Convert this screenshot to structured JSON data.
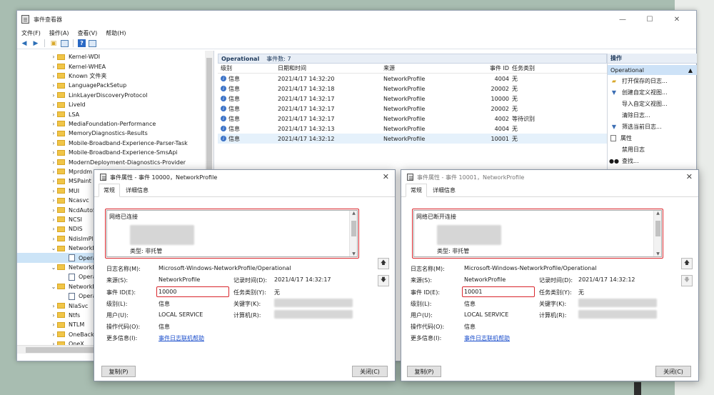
{
  "window": {
    "title": "事件查看器"
  },
  "menu": [
    "文件(F)",
    "操作(A)",
    "查看(V)",
    "帮助(H)"
  ],
  "tree": {
    "items": [
      {
        "label": "Kernel-WDI",
        "type": "folder"
      },
      {
        "label": "Kernel-WHEA",
        "type": "folder"
      },
      {
        "label": "Known 文件夹",
        "type": "folder"
      },
      {
        "label": "LanguagePackSetup",
        "type": "folder"
      },
      {
        "label": "LinkLayerDiscoveryProtocol",
        "type": "folder"
      },
      {
        "label": "Liveld",
        "type": "folder"
      },
      {
        "label": "LSA",
        "type": "folder"
      },
      {
        "label": "MediaFoundation-Performance",
        "type": "folder"
      },
      {
        "label": "MemoryDiagnostics-Results",
        "type": "folder"
      },
      {
        "label": "Mobile-Broadband-Experience-Parser-Task",
        "type": "folder"
      },
      {
        "label": "Mobile-Broadband-Experience-SmsApi",
        "type": "folder"
      },
      {
        "label": "ModernDeployment-Diagnostics-Provider",
        "type": "folder"
      },
      {
        "label": "Mprddm",
        "type": "folder"
      },
      {
        "label": "MSPaint",
        "type": "folder"
      },
      {
        "label": "MUI",
        "type": "folder"
      },
      {
        "label": "Ncasvc",
        "type": "folder"
      },
      {
        "label": "NcdAutoS",
        "type": "folder"
      },
      {
        "label": "NCSI",
        "type": "folder"
      },
      {
        "label": "NDIS",
        "type": "folder"
      },
      {
        "label": "NdisImPla",
        "type": "folder"
      },
      {
        "label": "NetworkP",
        "type": "folder-open"
      },
      {
        "label": "Opera",
        "type": "log",
        "selected": true
      },
      {
        "label": "NetworkP",
        "type": "folder-open"
      },
      {
        "label": "Opera",
        "type": "log"
      },
      {
        "label": "NetworkP",
        "type": "folder-open"
      },
      {
        "label": "Opera",
        "type": "log"
      },
      {
        "label": "NlaSvc",
        "type": "folder"
      },
      {
        "label": "Ntfs",
        "type": "folder"
      },
      {
        "label": "NTLM",
        "type": "folder"
      },
      {
        "label": "OneBacku",
        "type": "folder"
      },
      {
        "label": "OneX",
        "type": "folder"
      }
    ]
  },
  "center": {
    "header_title": "Operational",
    "header_count": "事件数: 7",
    "columns": [
      "级别",
      "日期和时间",
      "来源",
      "事件 ID",
      "任务类别"
    ],
    "rows": [
      {
        "level": "信息",
        "time": "2021/4/17 14:32:20",
        "source": "NetworkProfile",
        "id": "4004",
        "task": "无"
      },
      {
        "level": "信息",
        "time": "2021/4/17 14:32:18",
        "source": "NetworkProfile",
        "id": "20002",
        "task": "无"
      },
      {
        "level": "信息",
        "time": "2021/4/17 14:32:17",
        "source": "NetworkProfile",
        "id": "10000",
        "task": "无"
      },
      {
        "level": "信息",
        "time": "2021/4/17 14:32:17",
        "source": "NetworkProfile",
        "id": "20002",
        "task": "无"
      },
      {
        "level": "信息",
        "time": "2021/4/17 14:32:17",
        "source": "NetworkProfile",
        "id": "4002",
        "task": "等待识别"
      },
      {
        "level": "信息",
        "time": "2021/4/17 14:32:13",
        "source": "NetworkProfile",
        "id": "4004",
        "task": "无"
      },
      {
        "level": "信息",
        "time": "2021/4/17 14:32:12",
        "source": "NetworkProfile",
        "id": "10001",
        "task": "无"
      }
    ]
  },
  "actions": {
    "header": "操作",
    "selected": "Operational",
    "items": [
      "打开保存的日志...",
      "创建自定义视图...",
      "导入自定义视图...",
      "清除日志...",
      "筛选当前日志...",
      "属性",
      "禁用日志",
      "查找..."
    ]
  },
  "dialog1": {
    "title": "事件属性 - 事件 10000，NetworkProfile",
    "tab_general": "常规",
    "tab_details": "详细信息",
    "desc_line1": "网络已连接",
    "desc_type": "类型: 非托管",
    "log_name_label": "日志名称(M):",
    "log_name": "Microsoft-Windows-NetworkProfile/Operational",
    "source_label": "来源(S):",
    "source": "NetworkProfile",
    "logged_label": "记录时间(D):",
    "logged": "2021/4/17 14:32:17",
    "event_id_label": "事件 ID(E):",
    "event_id": "10000",
    "task_label": "任务类别(Y):",
    "task": "无",
    "level_label": "级别(L):",
    "level": "信息",
    "keywords_label": "关键字(K):",
    "user_label": "用户(U):",
    "user": "LOCAL SERVICE",
    "computer_label": "计算机(R):",
    "opcode_label": "操作代码(O):",
    "opcode": "信息",
    "more_label": "更多信息(I):",
    "more_link": "事件日志联机帮助",
    "copy_btn": "复制(P)",
    "close_btn": "关闭(C)"
  },
  "dialog2": {
    "title": "事件属性 - 事件 10001，NetworkProfile",
    "tab_general": "常规",
    "tab_details": "详细信息",
    "desc_line1": "网络已断开连接",
    "desc_type": "类型: 非托管",
    "log_name_label": "日志名称(M):",
    "log_name": "Microsoft-Windows-NetworkProfile/Operational",
    "source_label": "来源(S):",
    "source": "NetworkProfile",
    "logged_label": "记录时间(D):",
    "logged": "2021/4/17 14:32:12",
    "event_id_label": "事件 ID(E):",
    "event_id": "10001",
    "task_label": "任务类别(Y):",
    "task": "无",
    "level_label": "级别(L):",
    "level": "信息",
    "keywords_label": "关键字(K):",
    "user_label": "用户(U):",
    "user": "LOCAL SERVICE",
    "computer_label": "计算机(R):",
    "opcode_label": "操作代码(O):",
    "opcode": "信息",
    "more_label": "更多信息(I):",
    "more_link": "事件日志联机帮助",
    "copy_btn": "复制(P)",
    "close_btn": "关闭(C)"
  },
  "colors": {
    "highlight_red": "#d9262c",
    "selection_blue": "#cce4f7",
    "link_blue": "#1c4fcc"
  }
}
